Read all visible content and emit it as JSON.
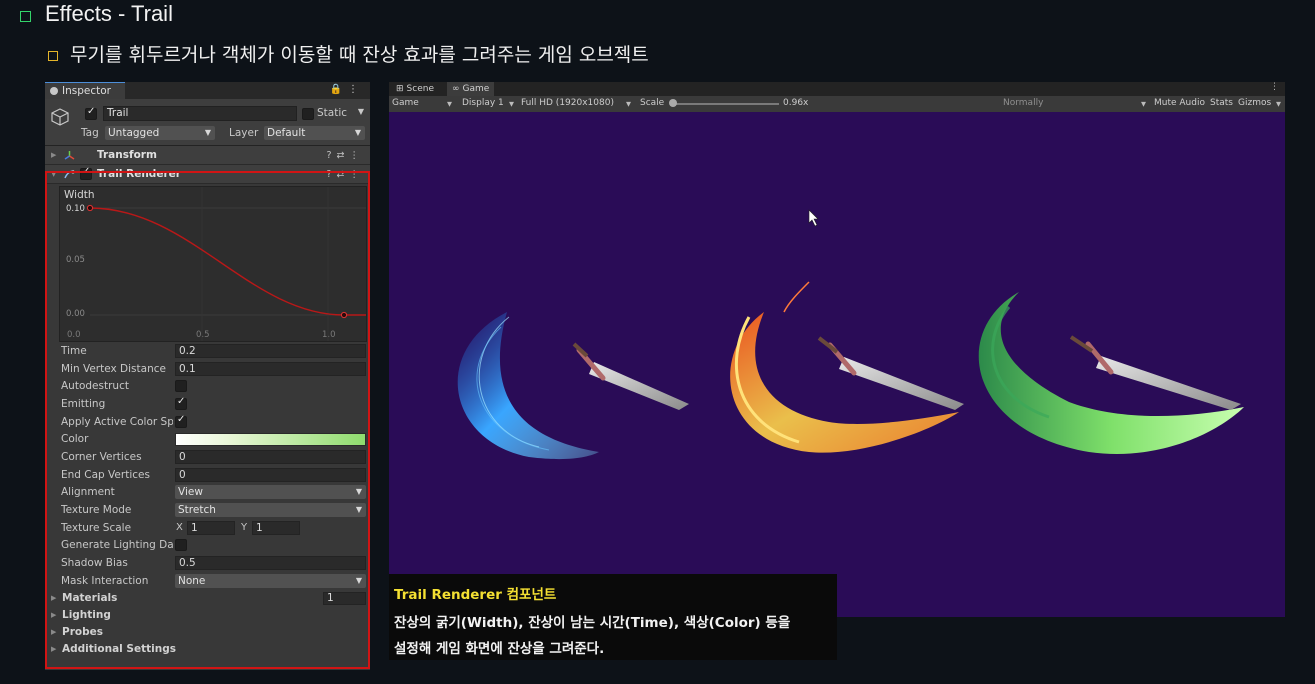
{
  "slide": {
    "title": "Effects - Trail",
    "subtitle": "무기를 휘두르거나 객체가 이동할 때 잔상 효과를 그려주는 게임 오브젝트"
  },
  "inspector": {
    "tab_label": "Inspector",
    "gameobject": {
      "name": "Trail",
      "active": true,
      "static_label": "Static",
      "tag_label": "Tag",
      "tag_value": "Untagged",
      "layer_label": "Layer",
      "layer_value": "Default"
    },
    "components": {
      "transform": "Transform",
      "trail_renderer": "Trail Renderer"
    },
    "width_curve": {
      "label": "Width",
      "y_ticks": [
        "0.10",
        "0.05",
        "0.00"
      ],
      "x_ticks": [
        "0.0",
        "0.5",
        "1.0"
      ],
      "key_start": 0.1,
      "key_end": 0.0
    },
    "properties": {
      "time_label": "Time",
      "time_value": "0.2",
      "min_vertex_label": "Min Vertex Distance",
      "min_vertex_value": "0.1",
      "autodestruct_label": "Autodestruct",
      "autodestruct": false,
      "emitting_label": "Emitting",
      "emitting": true,
      "apply_color_label": "Apply Active Color Sp",
      "apply_color": true,
      "color_label": "Color",
      "corner_label": "Corner Vertices",
      "corner_value": "0",
      "endcap_label": "End Cap Vertices",
      "endcap_value": "0",
      "alignment_label": "Alignment",
      "alignment_value": "View",
      "texture_mode_label": "Texture Mode",
      "texture_mode_value": "Stretch",
      "texture_scale_label": "Texture Scale",
      "x_label": "X",
      "x_value": "1",
      "y_label": "Y",
      "y_value": "1",
      "gen_light_label": "Generate Lighting Da",
      "gen_light": false,
      "shadow_bias_label": "Shadow Bias",
      "shadow_bias_value": "0.5",
      "mask_label": "Mask Interaction",
      "mask_value": "None"
    },
    "sections": {
      "materials": "Materials",
      "materials_count": "1",
      "lighting": "Lighting",
      "probes": "Probes",
      "additional": "Additional Settings"
    }
  },
  "game_view": {
    "tabs": [
      "Scene",
      "Game"
    ],
    "toolbar": {
      "mode": "Game",
      "display": "Display 1",
      "resolution": "Full HD (1920x1080)",
      "scale_label": "Scale",
      "scale_value": "0.96x",
      "play_focus": "Normally",
      "mute": "Mute Audio",
      "stats": "Stats",
      "gizmos": "Gizmos"
    },
    "colors": {
      "background": "#2a0c57",
      "trail_blue": "#3fb4ff",
      "trail_fire": "#ffb32a",
      "trail_green": "#8fe57a"
    }
  },
  "caption": {
    "title": "Trail Renderer 컴포넌트",
    "line1": "잔상의 굵기(Width), 잔상이 남는 시간(Time), 색상(Color) 등을",
    "line2": "설정해 게임 화면에 잔상을 그려준다."
  }
}
